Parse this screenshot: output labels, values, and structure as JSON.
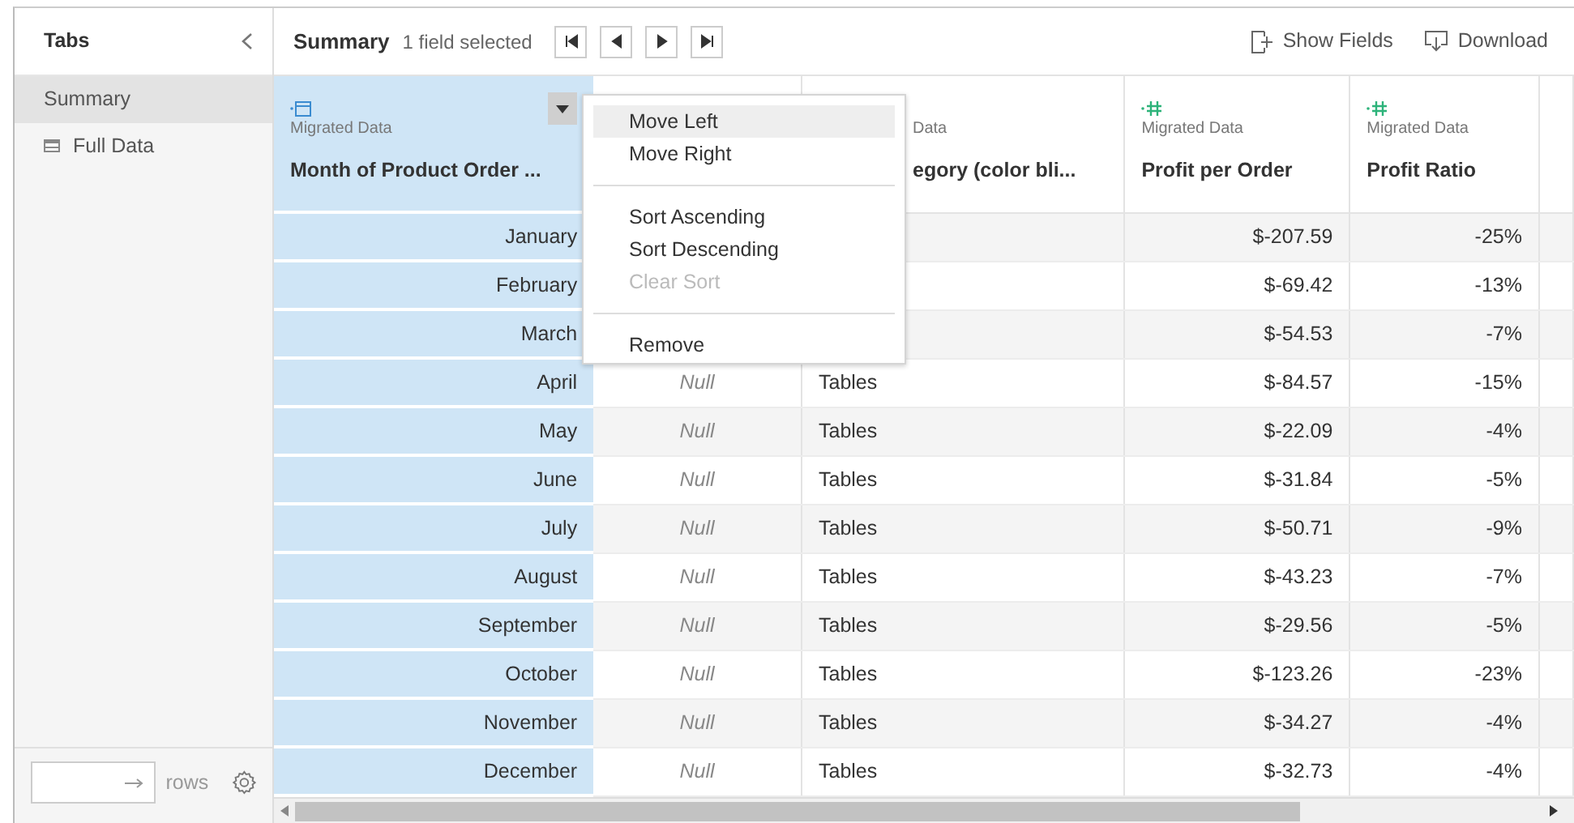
{
  "sidebar": {
    "title": "Tabs",
    "items": [
      {
        "label": "Summary",
        "kind": "summary",
        "selected": true
      },
      {
        "label": "Full Data",
        "kind": "table",
        "selected": false
      }
    ],
    "rows_label": "rows"
  },
  "toolbar": {
    "title": "Summary",
    "selection": "1 field selected",
    "actions": [
      {
        "label": "Show Fields",
        "kind": "add"
      },
      {
        "label": "Download",
        "kind": "download"
      }
    ]
  },
  "table": {
    "columns": [
      {
        "kind": "date",
        "source": "Migrated Data",
        "name": "Month of Product Order ...",
        "selected": true
      },
      {
        "selected": false
      },
      {
        "source": "Data",
        "name": "egory (color bli...",
        "selected": false
      },
      {
        "kind": "number",
        "source": "Migrated Data",
        "name": "Profit per Order",
        "selected": false
      },
      {
        "kind": "number",
        "source": "Migrated Data",
        "name": "Profit Ratio",
        "selected": false
      }
    ],
    "rows": [
      [
        "January",
        null,
        null,
        "$-207.59",
        "-25%"
      ],
      [
        "February",
        null,
        null,
        "$-69.42",
        "-13%"
      ],
      [
        "March",
        null,
        null,
        "$-54.53",
        "-7%"
      ],
      [
        "April",
        "Null",
        "Tables",
        "$-84.57",
        "-15%"
      ],
      [
        "May",
        "Null",
        "Tables",
        "$-22.09",
        "-4%"
      ],
      [
        "June",
        "Null",
        "Tables",
        "$-31.84",
        "-5%"
      ],
      [
        "July",
        "Null",
        "Tables",
        "$-50.71",
        "-9%"
      ],
      [
        "August",
        "Null",
        "Tables",
        "$-43.23",
        "-7%"
      ],
      [
        "September",
        "Null",
        "Tables",
        "$-29.56",
        "-5%"
      ],
      [
        "October",
        "Null",
        "Tables",
        "$-123.26",
        "-23%"
      ],
      [
        "November",
        "Null",
        "Tables",
        "$-34.27",
        "-4%"
      ],
      [
        "December",
        "Null",
        "Tables",
        "$-32.73",
        "-4%"
      ]
    ]
  },
  "context_menu": {
    "items": [
      {
        "kind": "item",
        "label": "Move Left",
        "selected": true,
        "disabled": false
      },
      {
        "kind": "item",
        "label": "Move Right",
        "selected": false,
        "disabled": false
      },
      {
        "kind": "separator"
      },
      {
        "kind": "item",
        "label": "Sort Ascending",
        "selected": false,
        "disabled": false
      },
      {
        "kind": "item",
        "label": "Sort Descending",
        "selected": false,
        "disabled": false
      },
      {
        "kind": "item",
        "label": "Clear Sort",
        "selected": false,
        "disabled": true
      },
      {
        "kind": "separator"
      },
      {
        "kind": "item",
        "label": "Remove",
        "selected": false,
        "disabled": false
      }
    ]
  }
}
